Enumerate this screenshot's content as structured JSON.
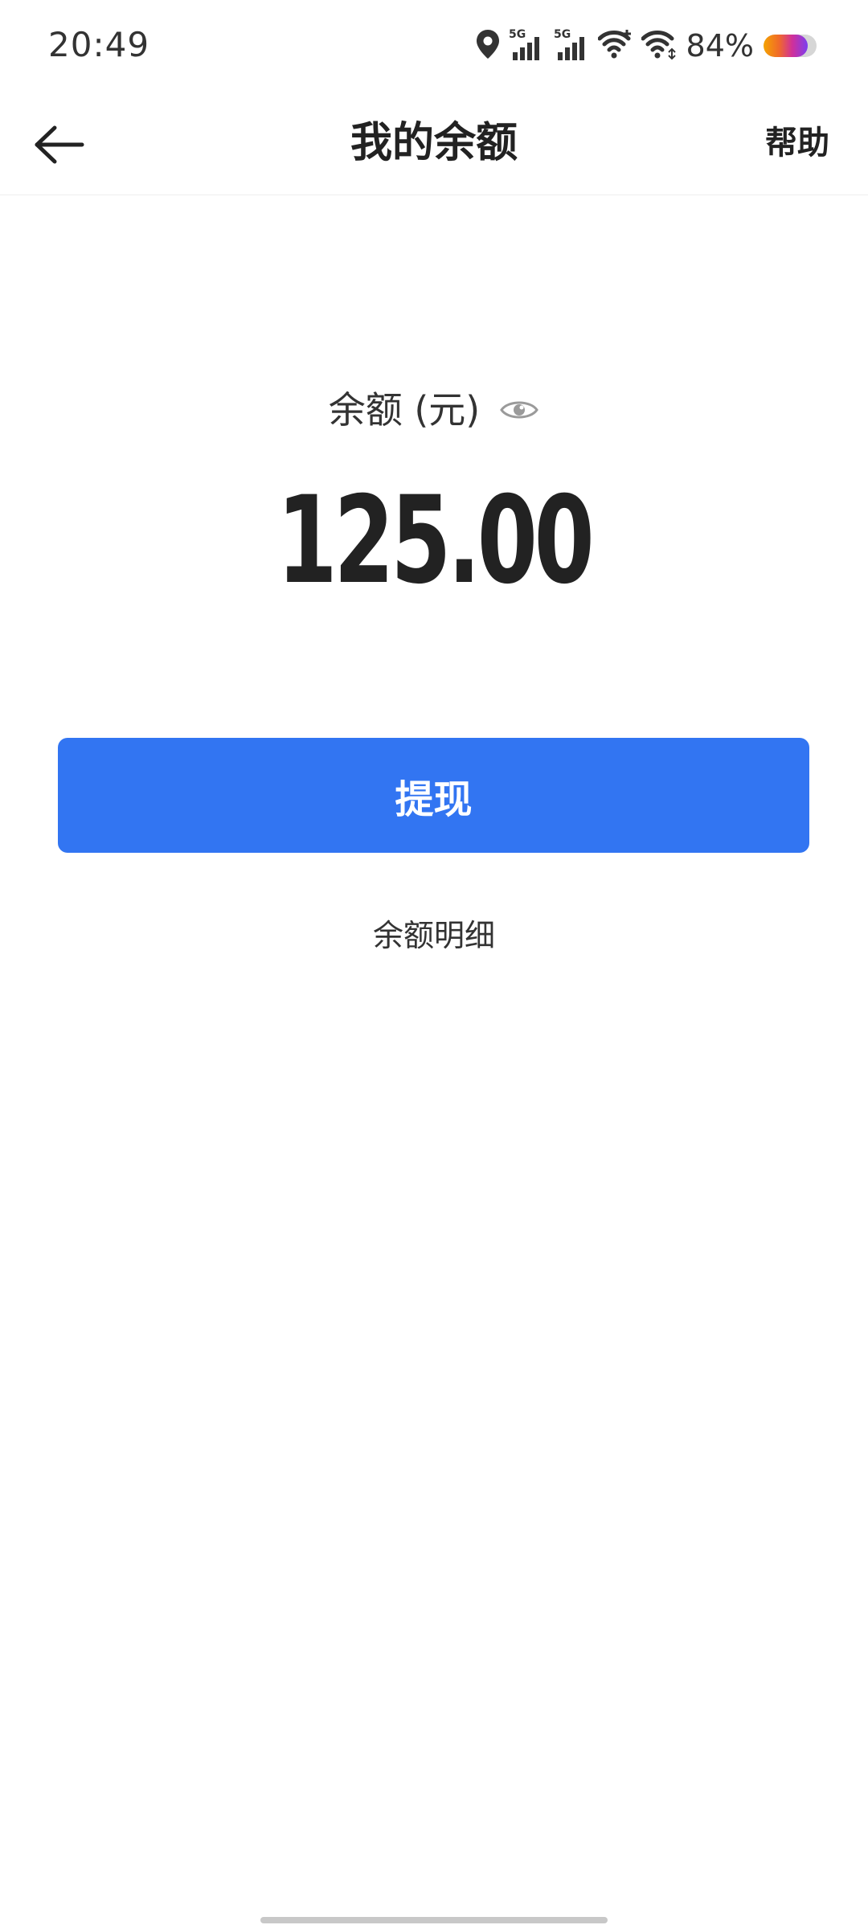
{
  "status_bar": {
    "time": "20:49",
    "battery_percent": "84%",
    "battery_level": 0.84,
    "icons": [
      "location-icon",
      "signal-5g-icon",
      "signal-5g-icon",
      "wifi-plus-icon",
      "wifi-icon",
      "battery-icon"
    ],
    "network_label": "5G"
  },
  "nav": {
    "title": "我的余额",
    "help_label": "帮助"
  },
  "balance": {
    "label": "余额 (元)",
    "amount": "125.00"
  },
  "actions": {
    "withdraw_label": "提现",
    "details_label": "余额明细"
  },
  "colors": {
    "primary": "#3275f2",
    "text": "#222222",
    "background": "#ffffff"
  }
}
